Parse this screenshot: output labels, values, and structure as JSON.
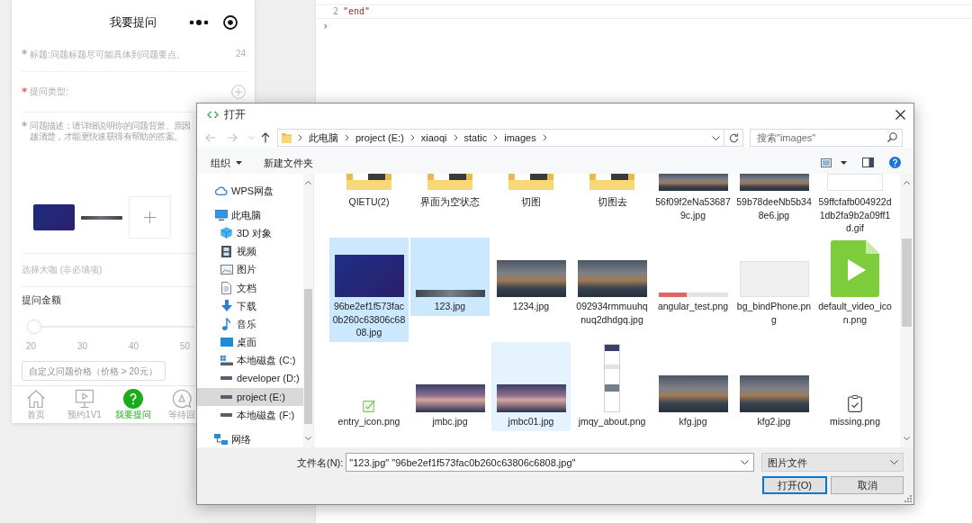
{
  "console": {
    "lines": [
      {
        "number": "2",
        "text": "\"end\""
      }
    ],
    "prompt": "›"
  },
  "phone": {
    "title": "我要提问",
    "fields": [
      {
        "kind": "input",
        "mark": "*",
        "color": "#a8a8a8",
        "placeholder": "标题:问题标题尽可能具体到问题要点。",
        "counter": "24"
      },
      {
        "kind": "picker",
        "mark": "*",
        "color": "#e8645c",
        "label": "提问类型:"
      },
      {
        "kind": "textarea",
        "mark": "*",
        "color": "#a8a8a8",
        "placeholder_lines": [
          "问题描述：请详细说明你的问题背景、原因",
          "越清楚，才能更快速获得有帮助的答案。"
        ]
      }
    ],
    "attachments": [
      {
        "kind": "banner"
      },
      {
        "kind": "strip"
      },
      {
        "kind": "add"
      }
    ],
    "expert": {
      "label": "选择大咖 (非必填项)"
    },
    "amount": {
      "label": "提问金额",
      "level": 0,
      "ticks": [
        "20",
        "30",
        "40",
        "50"
      ],
      "custom_price": {
        "placeholder": "自定义问题价格（价格 > 20元）"
      }
    },
    "tabs": [
      {
        "kind": "home",
        "label": "首页",
        "selected": false
      },
      {
        "kind": "booking",
        "label": "预约1V1",
        "selected": false
      },
      {
        "kind": "ask",
        "label": "我要提问",
        "selected": true
      },
      {
        "kind": "answers",
        "label": "等待回",
        "selected": false
      }
    ]
  },
  "dialog": {
    "title": "打开",
    "nav_buttons": [
      {
        "kind": "back",
        "disabled": true
      },
      {
        "kind": "forward",
        "disabled": true
      },
      {
        "kind": "recent",
        "disabled": true
      },
      {
        "kind": "up",
        "disabled": false
      }
    ],
    "path": [
      "此电脑",
      "project (E:)",
      "xiaoqi",
      "static",
      "images"
    ],
    "search": {
      "placeholder": "搜索\"images\""
    },
    "toolbar": [
      {
        "kind": "menu",
        "label": "组织"
      },
      {
        "kind": "button",
        "label": "新建文件夹"
      }
    ],
    "sidebar": {
      "items": [
        {
          "kind": "cloud",
          "label": "WPS网盘",
          "selected": false
        },
        {
          "kind": "pc",
          "label": "此电脑",
          "selected": false,
          "children": [
            {
              "kind": "objects",
              "label": "3D 对象",
              "selected": false
            },
            {
              "kind": "videos",
              "label": "视频",
              "selected": false
            },
            {
              "kind": "pictures",
              "label": "图片",
              "selected": false
            },
            {
              "kind": "documents",
              "label": "文档",
              "selected": false
            },
            {
              "kind": "downloads",
              "label": "下载",
              "selected": false
            },
            {
              "kind": "music",
              "label": "音乐",
              "selected": false
            },
            {
              "kind": "desktop",
              "label": "桌面",
              "selected": false
            },
            {
              "kind": "system-drive",
              "label": "本地磁盘 (C:)",
              "selected": false
            },
            {
              "kind": "drive",
              "label": "developer (D:)",
              "selected": false
            },
            {
              "kind": "drive",
              "label": "project (E:)",
              "selected": true
            },
            {
              "kind": "drive",
              "label": "本地磁盘 (F:)",
              "selected": false
            }
          ]
        },
        {
          "kind": "network",
          "label": "网络",
          "selected": false
        }
      ]
    },
    "files": {
      "rows": [
        [
          {
            "name": "QIETU(2)",
            "kind": "folder",
            "selected": false,
            "hovered": false
          },
          {
            "name": "界面为空状态",
            "kind": "folder",
            "selected": false,
            "hovered": false
          },
          {
            "name": "切图",
            "kind": "folder",
            "selected": false,
            "hovered": false
          },
          {
            "name": "切图去",
            "kind": "folder",
            "selected": false,
            "hovered": false
          },
          {
            "name": "56f09f2eNa536879c.jpg",
            "kind": "photo",
            "selected": false,
            "hovered": false
          },
          {
            "name": "59b78deeNb5b348e6.jpg",
            "kind": "photo",
            "selected": false,
            "hovered": false
          },
          {
            "name": "59ffcfafb004922d1db2fa9b2a09ff1d.gif",
            "kind": "sketch",
            "selected": false,
            "hovered": false
          }
        ],
        [
          {
            "name": "96be2ef1f573fac0b260c63806c6808.jpg",
            "kind": "banner",
            "selected": true,
            "hovered": false
          },
          {
            "name": "123.jpg",
            "kind": "strip",
            "selected": true,
            "hovered": false
          },
          {
            "name": "1234.jpg",
            "kind": "photo",
            "selected": false,
            "hovered": false
          },
          {
            "name": "092934rmmuuhqnuq2dhdgq.jpg",
            "kind": "photo",
            "selected": false,
            "hovered": false
          },
          {
            "name": "angular_test.png",
            "kind": "bar",
            "selected": false,
            "hovered": false
          },
          {
            "name": "bg_bindPhone.png",
            "kind": "light",
            "selected": false,
            "hovered": false
          },
          {
            "name": "default_video_icon.png",
            "kind": "video",
            "selected": false,
            "hovered": false
          }
        ],
        [
          {
            "name": "entry_icon.png",
            "kind": "check",
            "selected": false,
            "hovered": false
          },
          {
            "name": "jmbc.jpg",
            "kind": "panorama",
            "selected": false,
            "hovered": false
          },
          {
            "name": "jmbc01.jpg",
            "kind": "panorama",
            "selected": false,
            "hovered": true
          },
          {
            "name": "jmqy_about.png",
            "kind": "tall",
            "selected": false,
            "hovered": false
          },
          {
            "name": "kfg.jpg",
            "kind": "photo",
            "selected": false,
            "hovered": false
          },
          {
            "name": "kfg2.jpg",
            "kind": "photo",
            "selected": false,
            "hovered": false
          },
          {
            "name": "missing.png",
            "kind": "clipboard",
            "selected": false,
            "hovered": false
          }
        ]
      ]
    },
    "file_name": {
      "label": "文件名(N):",
      "value": "\"123.jpg\" \"96be2ef1f573fac0b260c63806c6808.jpg\""
    },
    "file_type": {
      "value": "图片文件"
    },
    "buttons": [
      {
        "label": "打开(O)",
        "default": true
      },
      {
        "label": "取消",
        "default": false
      }
    ]
  }
}
